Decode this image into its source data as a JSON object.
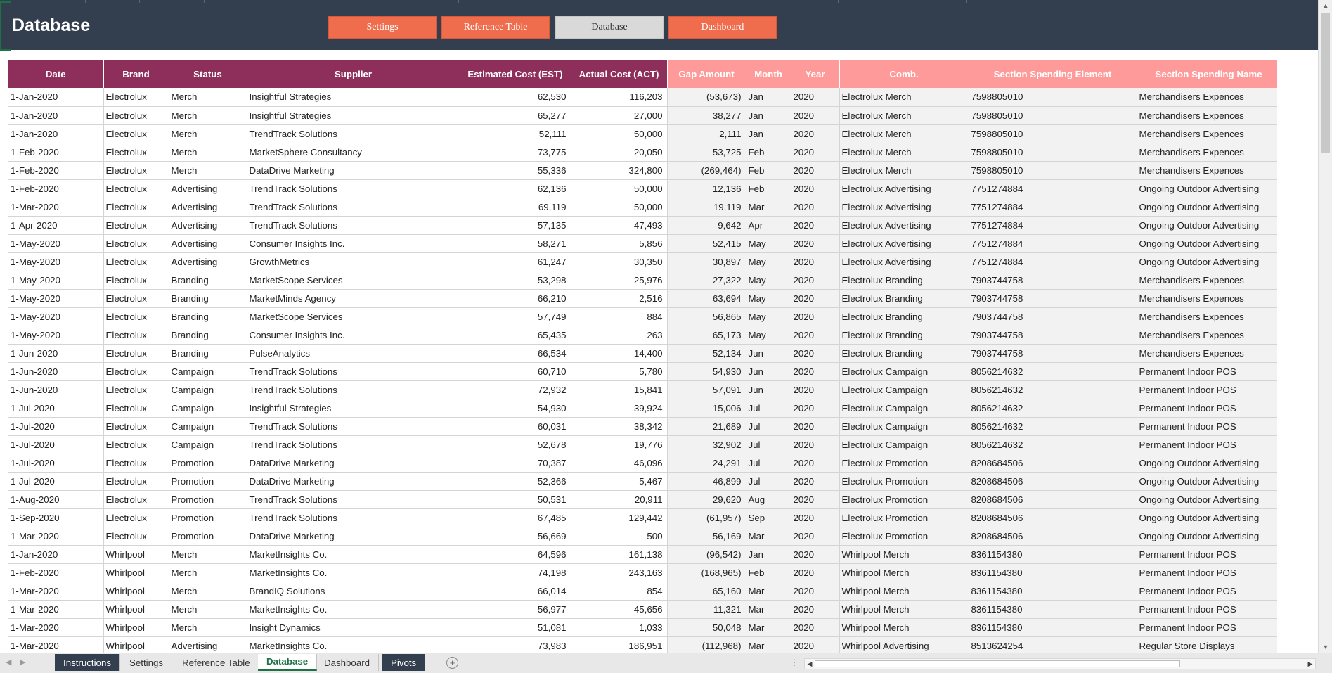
{
  "header": {
    "title": "Database",
    "nav_buttons": [
      "Settings",
      "Reference Table",
      "Database",
      "Dashboard"
    ]
  },
  "table": {
    "columns": [
      "Date",
      "Brand",
      "Status",
      "Supplier",
      "Estimated Cost (EST)",
      "Actual Cost (ACT)",
      "Gap Amount",
      "Month",
      "Year",
      "Comb.",
      "Section Spending Element",
      "Section Spending Name"
    ],
    "rows": [
      [
        "1-Jan-2020",
        "Electrolux",
        "Merch",
        "Insightful Strategies",
        "62,530",
        "116,203",
        "(53,673)",
        "Jan",
        "2020",
        "Electrolux Merch",
        "7598805010",
        "Merchandisers Expences"
      ],
      [
        "1-Jan-2020",
        "Electrolux",
        "Merch",
        "Insightful Strategies",
        "65,277",
        "27,000",
        "38,277",
        "Jan",
        "2020",
        "Electrolux Merch",
        "7598805010",
        "Merchandisers Expences"
      ],
      [
        "1-Jan-2020",
        "Electrolux",
        "Merch",
        "TrendTrack Solutions",
        "52,111",
        "50,000",
        "2,111",
        "Jan",
        "2020",
        "Electrolux Merch",
        "7598805010",
        "Merchandisers Expences"
      ],
      [
        "1-Feb-2020",
        "Electrolux",
        "Merch",
        "MarketSphere Consultancy",
        "73,775",
        "20,050",
        "53,725",
        "Feb",
        "2020",
        "Electrolux Merch",
        "7598805010",
        "Merchandisers Expences"
      ],
      [
        "1-Feb-2020",
        "Electrolux",
        "Merch",
        "DataDrive Marketing",
        "55,336",
        "324,800",
        "(269,464)",
        "Feb",
        "2020",
        "Electrolux Merch",
        "7598805010",
        "Merchandisers Expences"
      ],
      [
        "1-Feb-2020",
        "Electrolux",
        "Advertising",
        "TrendTrack Solutions",
        "62,136",
        "50,000",
        "12,136",
        "Feb",
        "2020",
        "Electrolux Advertising",
        "7751274884",
        "Ongoing Outdoor Advertising"
      ],
      [
        "1-Mar-2020",
        "Electrolux",
        "Advertising",
        "TrendTrack Solutions",
        "69,119",
        "50,000",
        "19,119",
        "Mar",
        "2020",
        "Electrolux Advertising",
        "7751274884",
        "Ongoing Outdoor Advertising"
      ],
      [
        "1-Apr-2020",
        "Electrolux",
        "Advertising",
        "TrendTrack Solutions",
        "57,135",
        "47,493",
        "9,642",
        "Apr",
        "2020",
        "Electrolux Advertising",
        "7751274884",
        "Ongoing Outdoor Advertising"
      ],
      [
        "1-May-2020",
        "Electrolux",
        "Advertising",
        "Consumer Insights Inc.",
        "58,271",
        "5,856",
        "52,415",
        "May",
        "2020",
        "Electrolux Advertising",
        "7751274884",
        "Ongoing Outdoor Advertising"
      ],
      [
        "1-May-2020",
        "Electrolux",
        "Advertising",
        "GrowthMetrics",
        "61,247",
        "30,350",
        "30,897",
        "May",
        "2020",
        "Electrolux Advertising",
        "7751274884",
        "Ongoing Outdoor Advertising"
      ],
      [
        "1-May-2020",
        "Electrolux",
        "Branding",
        "MarketScope Services",
        "53,298",
        "25,976",
        "27,322",
        "May",
        "2020",
        "Electrolux Branding",
        "7903744758",
        "Merchandisers Expences"
      ],
      [
        "1-May-2020",
        "Electrolux",
        "Branding",
        "MarketMinds Agency",
        "66,210",
        "2,516",
        "63,694",
        "May",
        "2020",
        "Electrolux Branding",
        "7903744758",
        "Merchandisers Expences"
      ],
      [
        "1-May-2020",
        "Electrolux",
        "Branding",
        "MarketScope Services",
        "57,749",
        "884",
        "56,865",
        "May",
        "2020",
        "Electrolux Branding",
        "7903744758",
        "Merchandisers Expences"
      ],
      [
        "1-May-2020",
        "Electrolux",
        "Branding",
        "Consumer Insights Inc.",
        "65,435",
        "263",
        "65,173",
        "May",
        "2020",
        "Electrolux Branding",
        "7903744758",
        "Merchandisers Expences"
      ],
      [
        "1-Jun-2020",
        "Electrolux",
        "Branding",
        "PulseAnalytics",
        "66,534",
        "14,400",
        "52,134",
        "Jun",
        "2020",
        "Electrolux Branding",
        "7903744758",
        "Merchandisers Expences"
      ],
      [
        "1-Jun-2020",
        "Electrolux",
        "Campaign",
        "TrendTrack Solutions",
        "60,710",
        "5,780",
        "54,930",
        "Jun",
        "2020",
        "Electrolux Campaign",
        "8056214632",
        "Permanent Indoor POS"
      ],
      [
        "1-Jun-2020",
        "Electrolux",
        "Campaign",
        "TrendTrack Solutions",
        "72,932",
        "15,841",
        "57,091",
        "Jun",
        "2020",
        "Electrolux Campaign",
        "8056214632",
        "Permanent Indoor POS"
      ],
      [
        "1-Jul-2020",
        "Electrolux",
        "Campaign",
        "Insightful Strategies",
        "54,930",
        "39,924",
        "15,006",
        "Jul",
        "2020",
        "Electrolux Campaign",
        "8056214632",
        "Permanent Indoor POS"
      ],
      [
        "1-Jul-2020",
        "Electrolux",
        "Campaign",
        "TrendTrack Solutions",
        "60,031",
        "38,342",
        "21,689",
        "Jul",
        "2020",
        "Electrolux Campaign",
        "8056214632",
        "Permanent Indoor POS"
      ],
      [
        "1-Jul-2020",
        "Electrolux",
        "Campaign",
        "TrendTrack Solutions",
        "52,678",
        "19,776",
        "32,902",
        "Jul",
        "2020",
        "Electrolux Campaign",
        "8056214632",
        "Permanent Indoor POS"
      ],
      [
        "1-Jul-2020",
        "Electrolux",
        "Promotion",
        "DataDrive Marketing",
        "70,387",
        "46,096",
        "24,291",
        "Jul",
        "2020",
        "Electrolux Promotion",
        "8208684506",
        "Ongoing Outdoor Advertising"
      ],
      [
        "1-Jul-2020",
        "Electrolux",
        "Promotion",
        "DataDrive Marketing",
        "52,366",
        "5,467",
        "46,899",
        "Jul",
        "2020",
        "Electrolux Promotion",
        "8208684506",
        "Ongoing Outdoor Advertising"
      ],
      [
        "1-Aug-2020",
        "Electrolux",
        "Promotion",
        "TrendTrack Solutions",
        "50,531",
        "20,911",
        "29,620",
        "Aug",
        "2020",
        "Electrolux Promotion",
        "8208684506",
        "Ongoing Outdoor Advertising"
      ],
      [
        "1-Sep-2020",
        "Electrolux",
        "Promotion",
        "TrendTrack Solutions",
        "67,485",
        "129,442",
        "(61,957)",
        "Sep",
        "2020",
        "Electrolux Promotion",
        "8208684506",
        "Ongoing Outdoor Advertising"
      ],
      [
        "1-Mar-2020",
        "Electrolux",
        "Promotion",
        "DataDrive Marketing",
        "56,669",
        "500",
        "56,169",
        "Mar",
        "2020",
        "Electrolux Promotion",
        "8208684506",
        "Ongoing Outdoor Advertising"
      ],
      [
        "1-Jan-2020",
        "Whirlpool",
        "Merch",
        "MarketInsights Co.",
        "64,596",
        "161,138",
        "(96,542)",
        "Jan",
        "2020",
        "Whirlpool Merch",
        "8361154380",
        "Permanent Indoor POS"
      ],
      [
        "1-Feb-2020",
        "Whirlpool",
        "Merch",
        "MarketInsights Co.",
        "74,198",
        "243,163",
        "(168,965)",
        "Feb",
        "2020",
        "Whirlpool Merch",
        "8361154380",
        "Permanent Indoor POS"
      ],
      [
        "1-Mar-2020",
        "Whirlpool",
        "Merch",
        "BrandIQ Solutions",
        "66,014",
        "854",
        "65,160",
        "Mar",
        "2020",
        "Whirlpool Merch",
        "8361154380",
        "Permanent Indoor POS"
      ],
      [
        "1-Mar-2020",
        "Whirlpool",
        "Merch",
        "MarketInsights Co.",
        "56,977",
        "45,656",
        "11,321",
        "Mar",
        "2020",
        "Whirlpool Merch",
        "8361154380",
        "Permanent Indoor POS"
      ],
      [
        "1-Mar-2020",
        "Whirlpool",
        "Merch",
        "Insight Dynamics",
        "51,081",
        "1,033",
        "50,048",
        "Mar",
        "2020",
        "Whirlpool Merch",
        "8361154380",
        "Permanent Indoor POS"
      ],
      [
        "1-Mar-2020",
        "Whirlpool",
        "Advertising",
        "MarketInsights Co.",
        "73,983",
        "186,951",
        "(112,968)",
        "Mar",
        "2020",
        "Whirlpool Advertising",
        "8513624254",
        "Regular Store Displays"
      ]
    ]
  },
  "sheet_tabs": [
    "Instructions",
    "Settings",
    "Reference Table",
    "Database",
    "Dashboard",
    "Pivots"
  ],
  "active_sheet": "Database",
  "icons": {
    "add_sheet": "plus-circle-icon",
    "scroll_up": "triangle-up-icon",
    "scroll_down": "triangle-down-icon",
    "scroll_left": "triangle-left-icon",
    "scroll_right": "triangle-right-icon"
  },
  "colors": {
    "header_band": "#333f4f",
    "nav_button": "#ef6c4c",
    "nav_button_active": "#d9d9d9",
    "column_header_dark": "#8e2e5b",
    "column_header_light": "#fe9a9a",
    "active_tab_accent": "#1e7145"
  }
}
